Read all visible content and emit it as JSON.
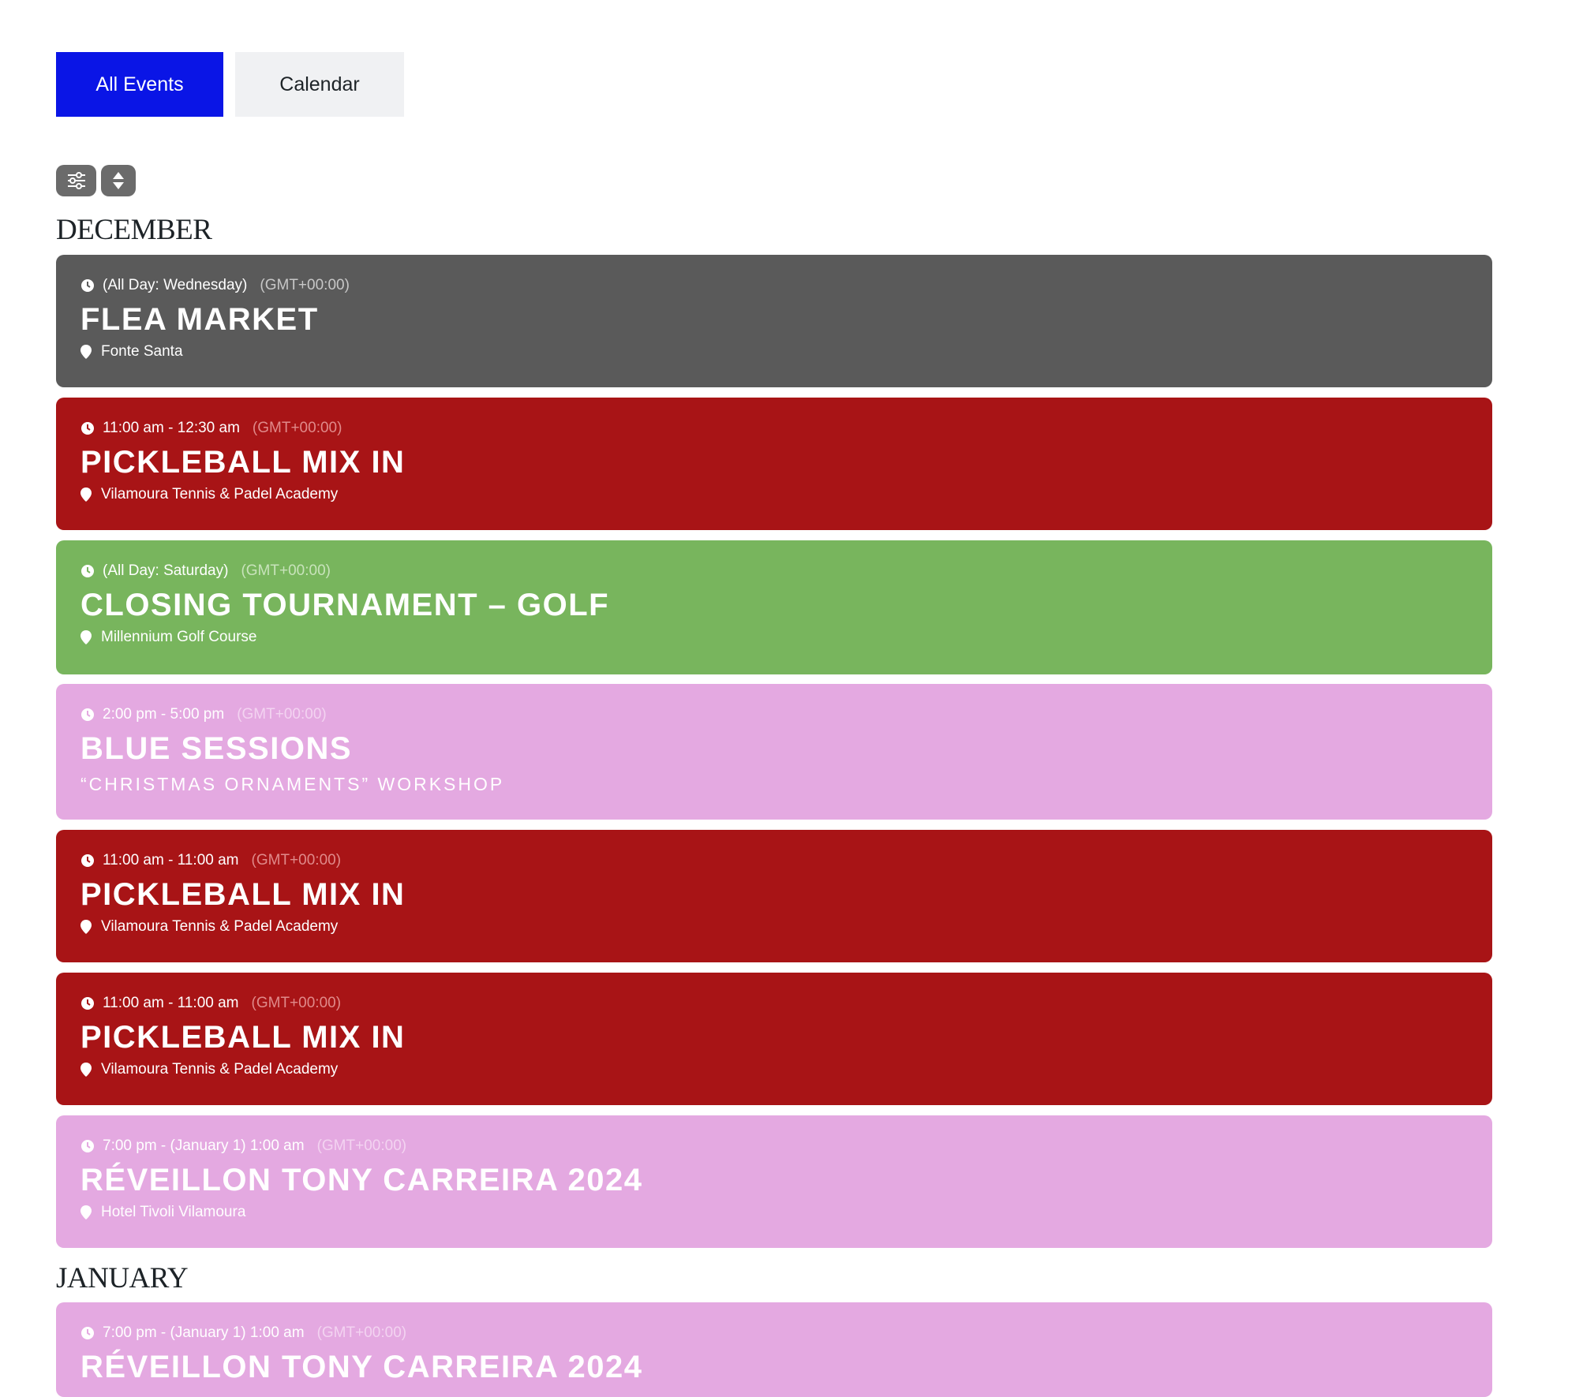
{
  "tabs": {
    "all_events": "All Events",
    "calendar": "Calendar"
  },
  "toolbar": {
    "filter_icon": "sliders-icon",
    "sort_icon": "sort-icon"
  },
  "colors": {
    "tab_active": "#0a15e6",
    "gray": "#5a5a5a",
    "red": "#a81416",
    "green": "#78b55d",
    "pink": "#e4a9e1"
  },
  "months": [
    {
      "label": "DECEMBER",
      "events": [
        {
          "time": "(All Day: Wednesday)",
          "tz": "(GMT+00:00)",
          "title": "FLEA MARKET",
          "location": "Fonte Santa",
          "color": "gray"
        },
        {
          "time": "11:00 am - 12:30 am",
          "tz": "(GMT+00:00)",
          "title": "PICKLEBALL MIX IN",
          "location": "Vilamoura Tennis & Padel Academy",
          "color": "red"
        },
        {
          "time": "(All Day: Saturday)",
          "tz": "(GMT+00:00)",
          "title": "CLOSING TOURNAMENT – GOLF",
          "location": "Millennium Golf Course",
          "color": "green"
        },
        {
          "time": "2:00 pm - 5:00 pm",
          "tz": "(GMT+00:00)",
          "title": "BLUE SESSIONS",
          "subtitle": "“CHRISTMAS ORNAMENTS” WORKSHOP",
          "color": "pink"
        },
        {
          "time": "11:00 am - 11:00 am",
          "tz": "(GMT+00:00)",
          "title": "PICKLEBALL MIX IN",
          "location": "Vilamoura Tennis & Padel Academy",
          "color": "red"
        },
        {
          "time": "11:00 am - 11:00 am",
          "tz": "(GMT+00:00)",
          "title": "PICKLEBALL MIX IN",
          "location": "Vilamoura Tennis & Padel Academy",
          "color": "red"
        },
        {
          "time": "7:00 pm - (January 1) 1:00 am",
          "tz": "(GMT+00:00)",
          "title": "RÉVEILLON TONY CARREIRA 2024",
          "location": "Hotel Tivoli Vilamoura",
          "color": "pink"
        }
      ]
    },
    {
      "label": "JANUARY",
      "events": [
        {
          "time": "7:00 pm - (January 1) 1:00 am",
          "tz": "(GMT+00:00)",
          "title": "RÉVEILLON TONY CARREIRA 2024",
          "color": "pink"
        }
      ]
    }
  ]
}
